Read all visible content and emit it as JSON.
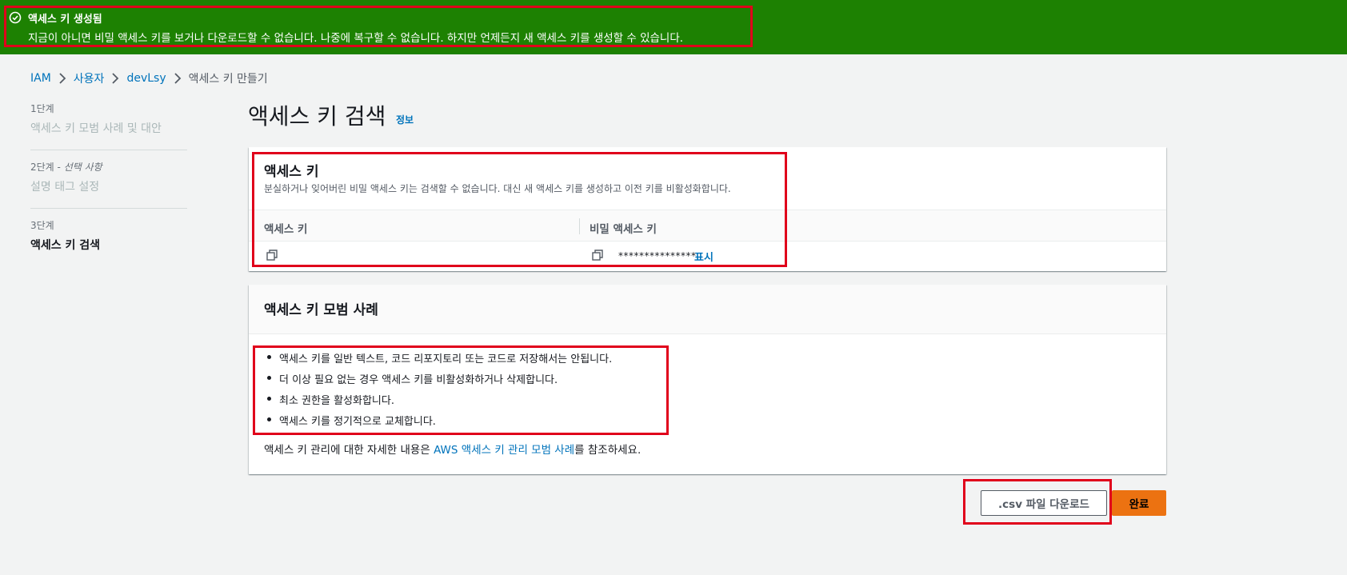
{
  "banner": {
    "title": "액세스 키 생성됨",
    "description": "지금이 아니면 비밀 액세스 키를 보거나 다운로드할 수 없습니다. 나중에 복구할 수 없습니다. 하지만 언제든지 새 액세스 키를 생성할 수 있습니다.",
    "background": "#1d8102"
  },
  "breadcrumb": {
    "items": [
      "IAM",
      "사용자",
      "devLsy"
    ],
    "current": "액세스 키 만들기"
  },
  "steps": [
    {
      "label": "1단계",
      "title": "액세스 키 모범 사례 및 대안"
    },
    {
      "label": "2단계 - ",
      "label_optional": "선택 사항",
      "title": "설명 태그 설정"
    },
    {
      "label": "3단계",
      "title": "액세스 키 검색"
    }
  ],
  "page": {
    "title": "액세스 키 검색",
    "info_link": "정보"
  },
  "access_key_card": {
    "title": "액세스 키",
    "description": "분실하거나 잊어버린 비밀 액세스 키는 검색할 수 없습니다. 대신 새 액세스 키를 생성하고 이전 키를 비활성화합니다.",
    "columns": [
      "액세스 키",
      "비밀 액세스 키"
    ],
    "access_key_value": "",
    "secret_mask": "***************",
    "show_label": "표시"
  },
  "best_practices": {
    "title": "액세스 키 모범 사례",
    "items": [
      "액세스 키를 일반 텍스트, 코드 리포지토리 또는 코드로 저장해서는 안됩니다.",
      "더 이상 필요 없는 경우 액세스 키를 비활성화하거나 삭제합니다.",
      "최소 권한을 활성화합니다.",
      "액세스 키를 정기적으로 교체합니다."
    ],
    "note_prefix": "액세스 키 관리에 대한 자세한 내용은 ",
    "note_link": "AWS 액세스 키 관리 모범 사례",
    "note_suffix": "를 참조하세요."
  },
  "actions": {
    "download_csv": ".csv 파일 다운로드",
    "done": "완료"
  },
  "colors": {
    "link": "#0073bb",
    "primary": "#ec7211",
    "highlight": "#e0001b"
  }
}
